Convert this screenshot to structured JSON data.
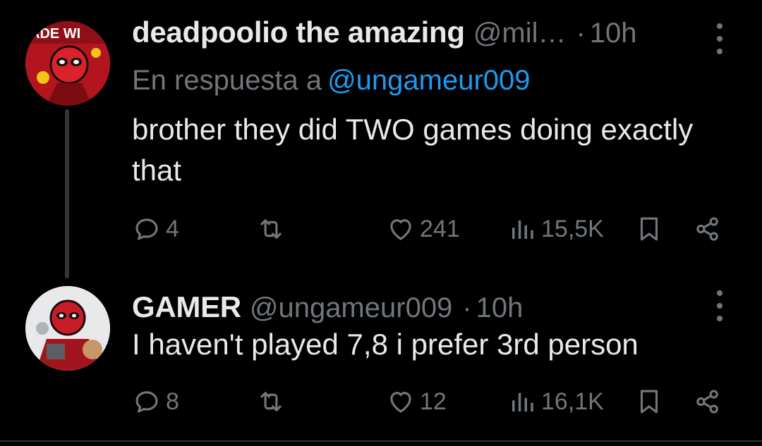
{
  "colors": {
    "background": "#000000",
    "text_primary": "#e7e9ea",
    "text_secondary": "#71767b",
    "link": "#1d9bf0",
    "thread_line": "#333639"
  },
  "tweets": [
    {
      "display_name": "deadpoolio the amazing",
      "handle": "@mil…",
      "separator": "·",
      "time": "10h",
      "reply_prefix": "En respuesta a",
      "reply_handle": "@ungameur009",
      "text": "brother they did TWO games doing exactly that",
      "avatar_icon": "avatar-deadpool-red",
      "avatar_text": "ADE WI",
      "actions": {
        "replies": "4",
        "retweets": "",
        "likes": "241",
        "views": "15,5K"
      }
    },
    {
      "display_name": "GAMER",
      "handle": "@ungameur009",
      "separator": "·",
      "time": "10h",
      "text": "I haven't played 7,8 i prefer 3rd person",
      "avatar_icon": "avatar-deadpool-white",
      "actions": {
        "replies": "8",
        "retweets": "",
        "likes": "12",
        "views": "16,1K"
      }
    }
  ]
}
